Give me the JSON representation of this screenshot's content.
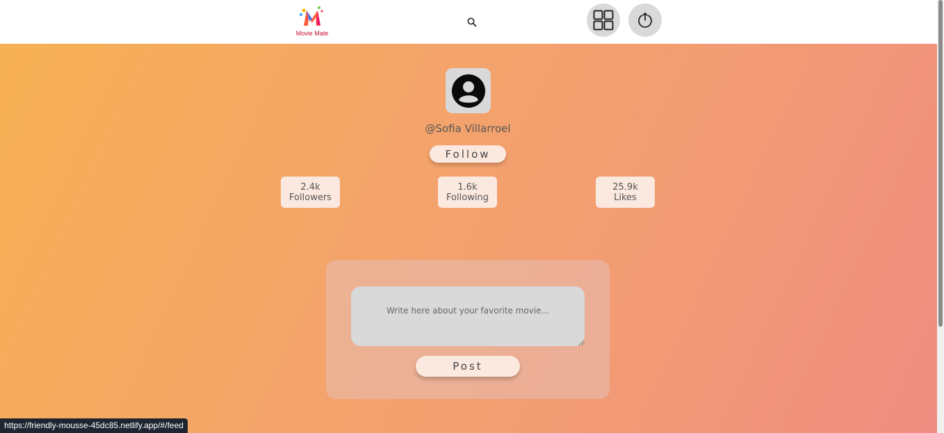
{
  "header": {
    "logo_text": "Movie Mate",
    "search_icon": "search-icon",
    "dashboard_icon": "grid-icon",
    "logout_icon": "power-icon"
  },
  "profile": {
    "avatar_icon": "user-avatar-icon",
    "username": "@Sofia Villarroel",
    "follow_label": "Follow",
    "stats": [
      {
        "value": "2.4k",
        "label": "Followers"
      },
      {
        "value": "1.6k",
        "label": "Following"
      },
      {
        "value": "25.9k",
        "label": "Likes"
      }
    ]
  },
  "composer": {
    "placeholder": "Write here about your favorite movie...",
    "post_label": "Post"
  },
  "status_url": "https://friendly-mousse-45dc85.netlify.app/#/feed",
  "colors": {
    "gradient_start": "#f7b154",
    "gradient_end": "#f08d82",
    "button_bg": "#fbe8df",
    "logo_red": "#c8102e"
  }
}
